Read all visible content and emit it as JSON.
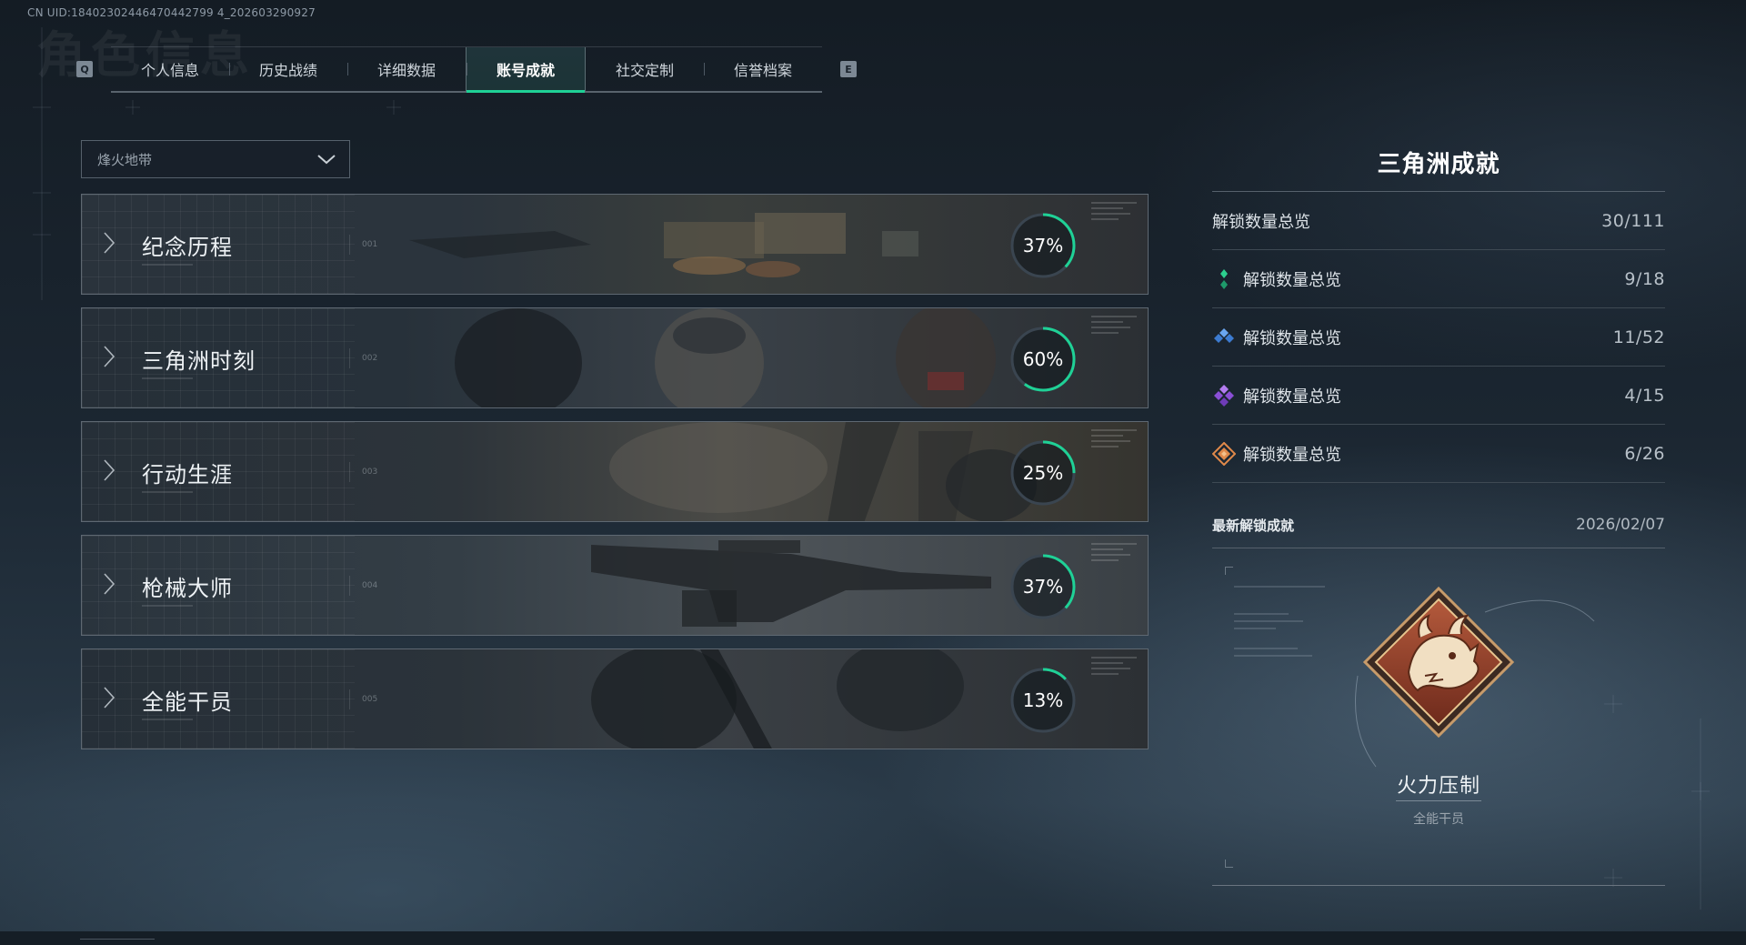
{
  "uid_text": "CN UID:18402302446470442799 4_202603290927",
  "watermark": "角色信息",
  "tabs": {
    "prev_key": "Q",
    "next_key": "E",
    "items": [
      {
        "label": "个人信息"
      },
      {
        "label": "历史战绩"
      },
      {
        "label": "详细数据"
      },
      {
        "label": "账号成就",
        "active": true
      },
      {
        "label": "社交定制"
      },
      {
        "label": "信誉档案"
      }
    ]
  },
  "mode_select": {
    "value": "烽火地带"
  },
  "categories": [
    {
      "title": "纪念历程",
      "index": "001",
      "percent": "37%",
      "progress": 0.37
    },
    {
      "title": "三角洲时刻",
      "index": "002",
      "percent": "60%",
      "progress": 0.6
    },
    {
      "title": "行动生涯",
      "index": "003",
      "percent": "25%",
      "progress": 0.25
    },
    {
      "title": "枪械大师",
      "index": "004",
      "percent": "37%",
      "progress": 0.37
    },
    {
      "title": "全能干员",
      "index": "005",
      "percent": "13%",
      "progress": 0.13
    }
  ],
  "panel": {
    "title": "三角洲成就",
    "total": {
      "label": "解锁数量总览",
      "value": "30/111"
    },
    "tiers": [
      {
        "label": "解锁数量总览",
        "value": "9/18",
        "icon": "tier-green-icon",
        "color": "#2ccf8e"
      },
      {
        "label": "解锁数量总览",
        "value": "11/52",
        "icon": "tier-blue-icon",
        "color": "#4d8fe0"
      },
      {
        "label": "解锁数量总览",
        "value": "4/15",
        "icon": "tier-purple-icon",
        "color": "#9b5fe0"
      },
      {
        "label": "解锁数量总览",
        "value": "6/26",
        "icon": "tier-orange-icon",
        "color": "#e0894a"
      }
    ],
    "latest": {
      "label": "最新解锁成就",
      "date": "2026/02/07",
      "badge_name": "火力压制",
      "badge_category": "全能干员",
      "badge_icon": "dragon-emblem-icon"
    }
  },
  "colors": {
    "accent": "#1fd196",
    "ring_track": "#3a4550"
  }
}
